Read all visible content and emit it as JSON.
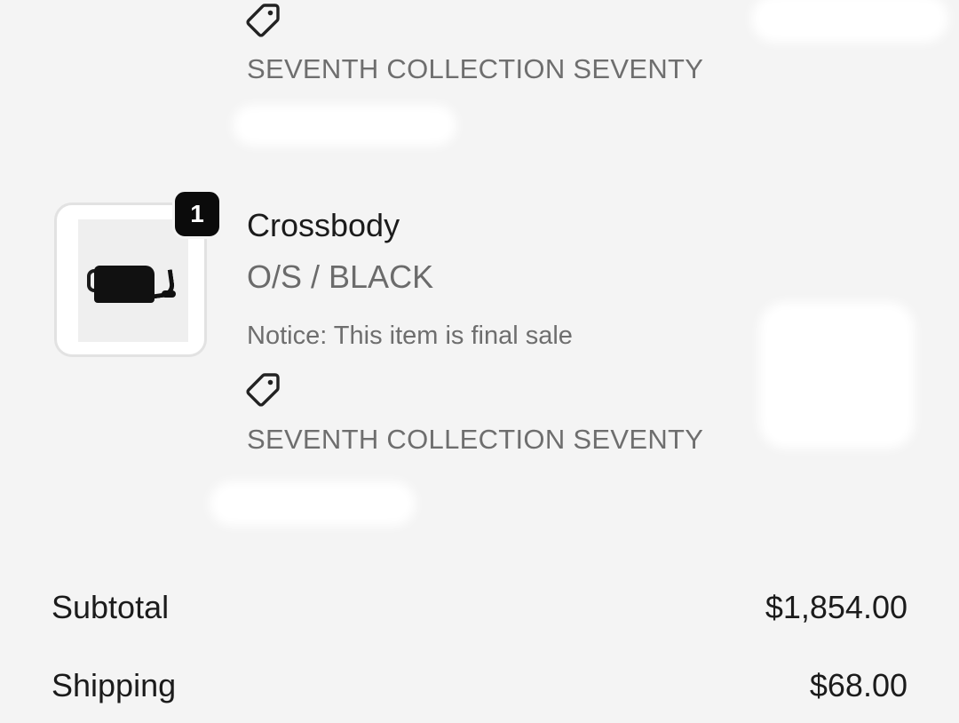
{
  "items": [
    {
      "discount_icon": "tag-icon",
      "discount_label": "SEVENTH COLLECTION SEVENTY"
    },
    {
      "quantity": "1",
      "name": "Crossbody",
      "variant": "O/S / BLACK",
      "notice": "Notice: This item is final sale",
      "discount_icon": "tag-icon",
      "discount_label": "SEVENTH COLLECTION SEVENTY",
      "thumbnail": "black crossbody bag"
    }
  ],
  "summary": {
    "subtotal_label": "Subtotal",
    "subtotal_value": "$1,854.00",
    "shipping_label": "Shipping",
    "shipping_value": "$68.00"
  }
}
